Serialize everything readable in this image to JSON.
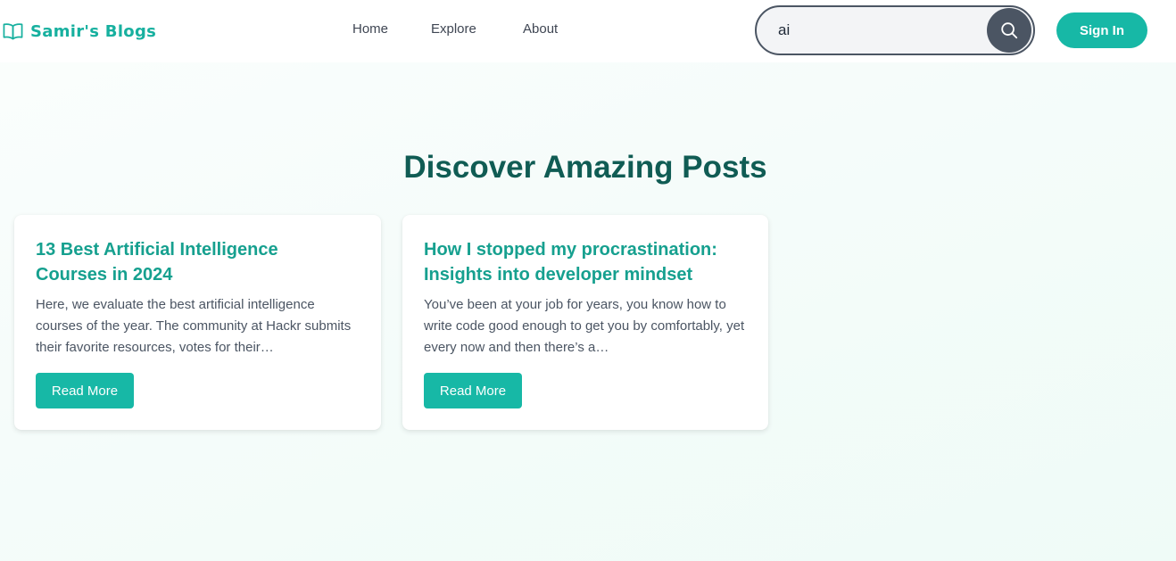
{
  "header": {
    "brand": {
      "icon": "book-open-icon",
      "text": "Samir's Blogs"
    },
    "nav": [
      {
        "label": "Home"
      },
      {
        "label": "Explore"
      },
      {
        "label": "About"
      }
    ],
    "search": {
      "value": "ai",
      "icon": "search-icon"
    },
    "signin_label": "Sign In"
  },
  "main": {
    "heading": "Discover Amazing Posts",
    "posts": [
      {
        "title": "13 Best Artificial Intelligence Courses in 2024",
        "excerpt": "Here, we evaluate the best artificial intelligence courses of the year. The community at Hackr submits their favorite resources, votes for their…",
        "button": "Read More"
      },
      {
        "title": "How I stopped my procrastination: Insights into developer mindset",
        "excerpt": "You’ve been at your job for years, you know how to write code good enough to get you by comfortably, yet every now and then there’s a…",
        "button": "Read More"
      }
    ]
  },
  "colors": {
    "brand": "#17b09f",
    "accent": "#17b8a6",
    "heading": "#105c54",
    "search_button": "#4b5563"
  }
}
